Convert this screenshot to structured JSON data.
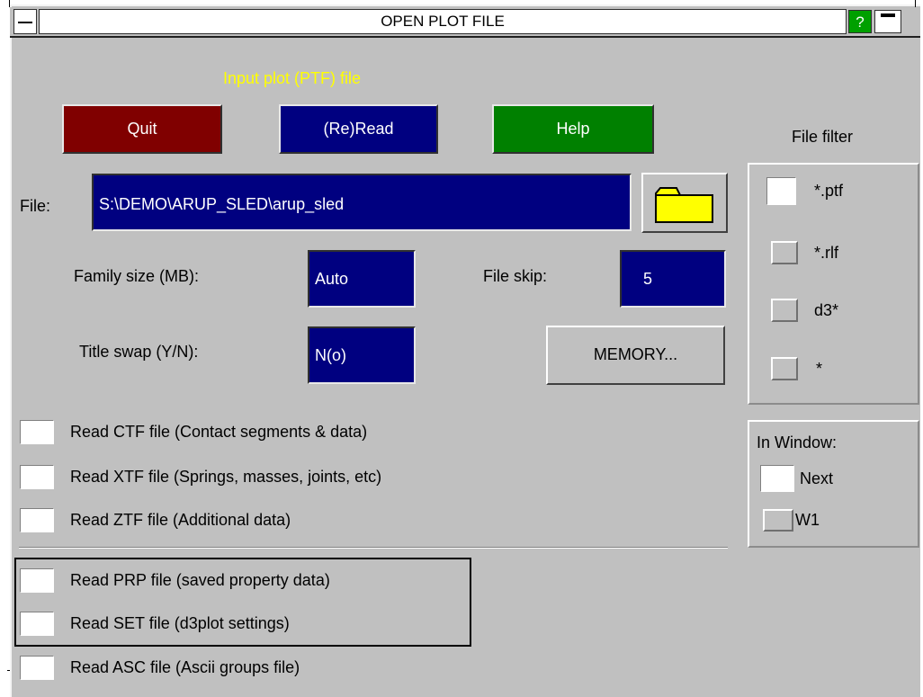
{
  "window": {
    "title": "OPEN PLOT FILE",
    "help_glyph": "?",
    "subtitle": "Input plot (PTF) file"
  },
  "colors": {
    "panel": "#c0c0c0",
    "quit": "#800000",
    "reread": "#000080",
    "help": "#008000",
    "subtitle": "#ffff00",
    "field": "#000080",
    "folder": "#ffff00"
  },
  "buttons": {
    "quit": "Quit",
    "reread": "(Re)Read",
    "help": "Help",
    "memory": "MEMORY..."
  },
  "file": {
    "label": "File:",
    "value": "S:\\DEMO\\ARUP_SLED\\arup_sled",
    "browse_icon": "folder-icon"
  },
  "family_size": {
    "label": "Family size (MB):",
    "value": "Auto"
  },
  "file_skip": {
    "label": "File skip:",
    "value": "5"
  },
  "title_swap": {
    "label": "Title swap (Y/N):",
    "value": "N(o)"
  },
  "options": [
    {
      "label": "Read CTF file (Contact segments & data)",
      "checked": false
    },
    {
      "label": "Read XTF file (Springs, masses, joints, etc)",
      "checked": false
    },
    {
      "label": "Read ZTF file (Additional data)",
      "checked": false
    },
    {
      "label": "Read PRP file (saved property data)",
      "checked": false
    },
    {
      "label": "Read SET file (d3plot settings)",
      "checked": false
    },
    {
      "label": "Read ASC file (Ascii groups file)",
      "checked": false
    }
  ],
  "file_filter": {
    "title": "File filter",
    "items": [
      {
        "label": "*.ptf",
        "selected": true
      },
      {
        "label": "*.rlf",
        "selected": false
      },
      {
        "label": "d3*",
        "selected": false
      },
      {
        "label": "*",
        "selected": false
      }
    ]
  },
  "in_window": {
    "title": "In Window:",
    "items": [
      {
        "label": "Next",
        "selected": true
      },
      {
        "label": "W1",
        "selected": false
      }
    ]
  }
}
